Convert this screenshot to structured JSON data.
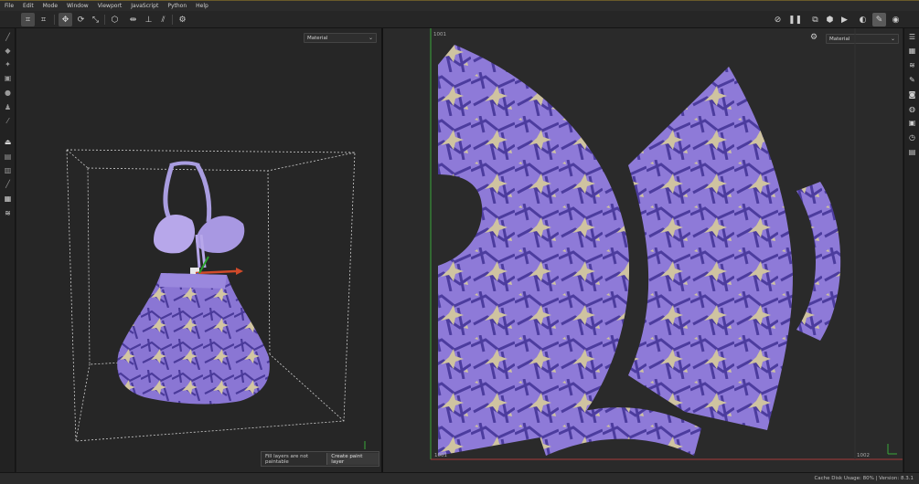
{
  "menu": [
    "File",
    "Edit",
    "Mode",
    "Window",
    "Viewport",
    "JavaScript",
    "Python",
    "Help"
  ],
  "viewport3d": {
    "material_dropdown": "Material"
  },
  "viewportUV": {
    "material_dropdown": "Material",
    "uv_tile_label": "1001",
    "uv_top_label": "1001",
    "uv_corner_label": "1002"
  },
  "toast": {
    "message": "Fill layers are not paintable",
    "action": "Create paint layer"
  },
  "statusbar": {
    "text": "Cache Disk Usage:  80% | Version: 8.3.1"
  },
  "colors": {
    "fabric_base": "#8e7ad8",
    "fabric_dark": "#4a3a9a",
    "fabric_pattern": "#c9bf9f",
    "uv_axis_green": "#3aa83a",
    "uv_axis_red": "#a83a3a",
    "accent_orange": "#6a5a2a"
  }
}
